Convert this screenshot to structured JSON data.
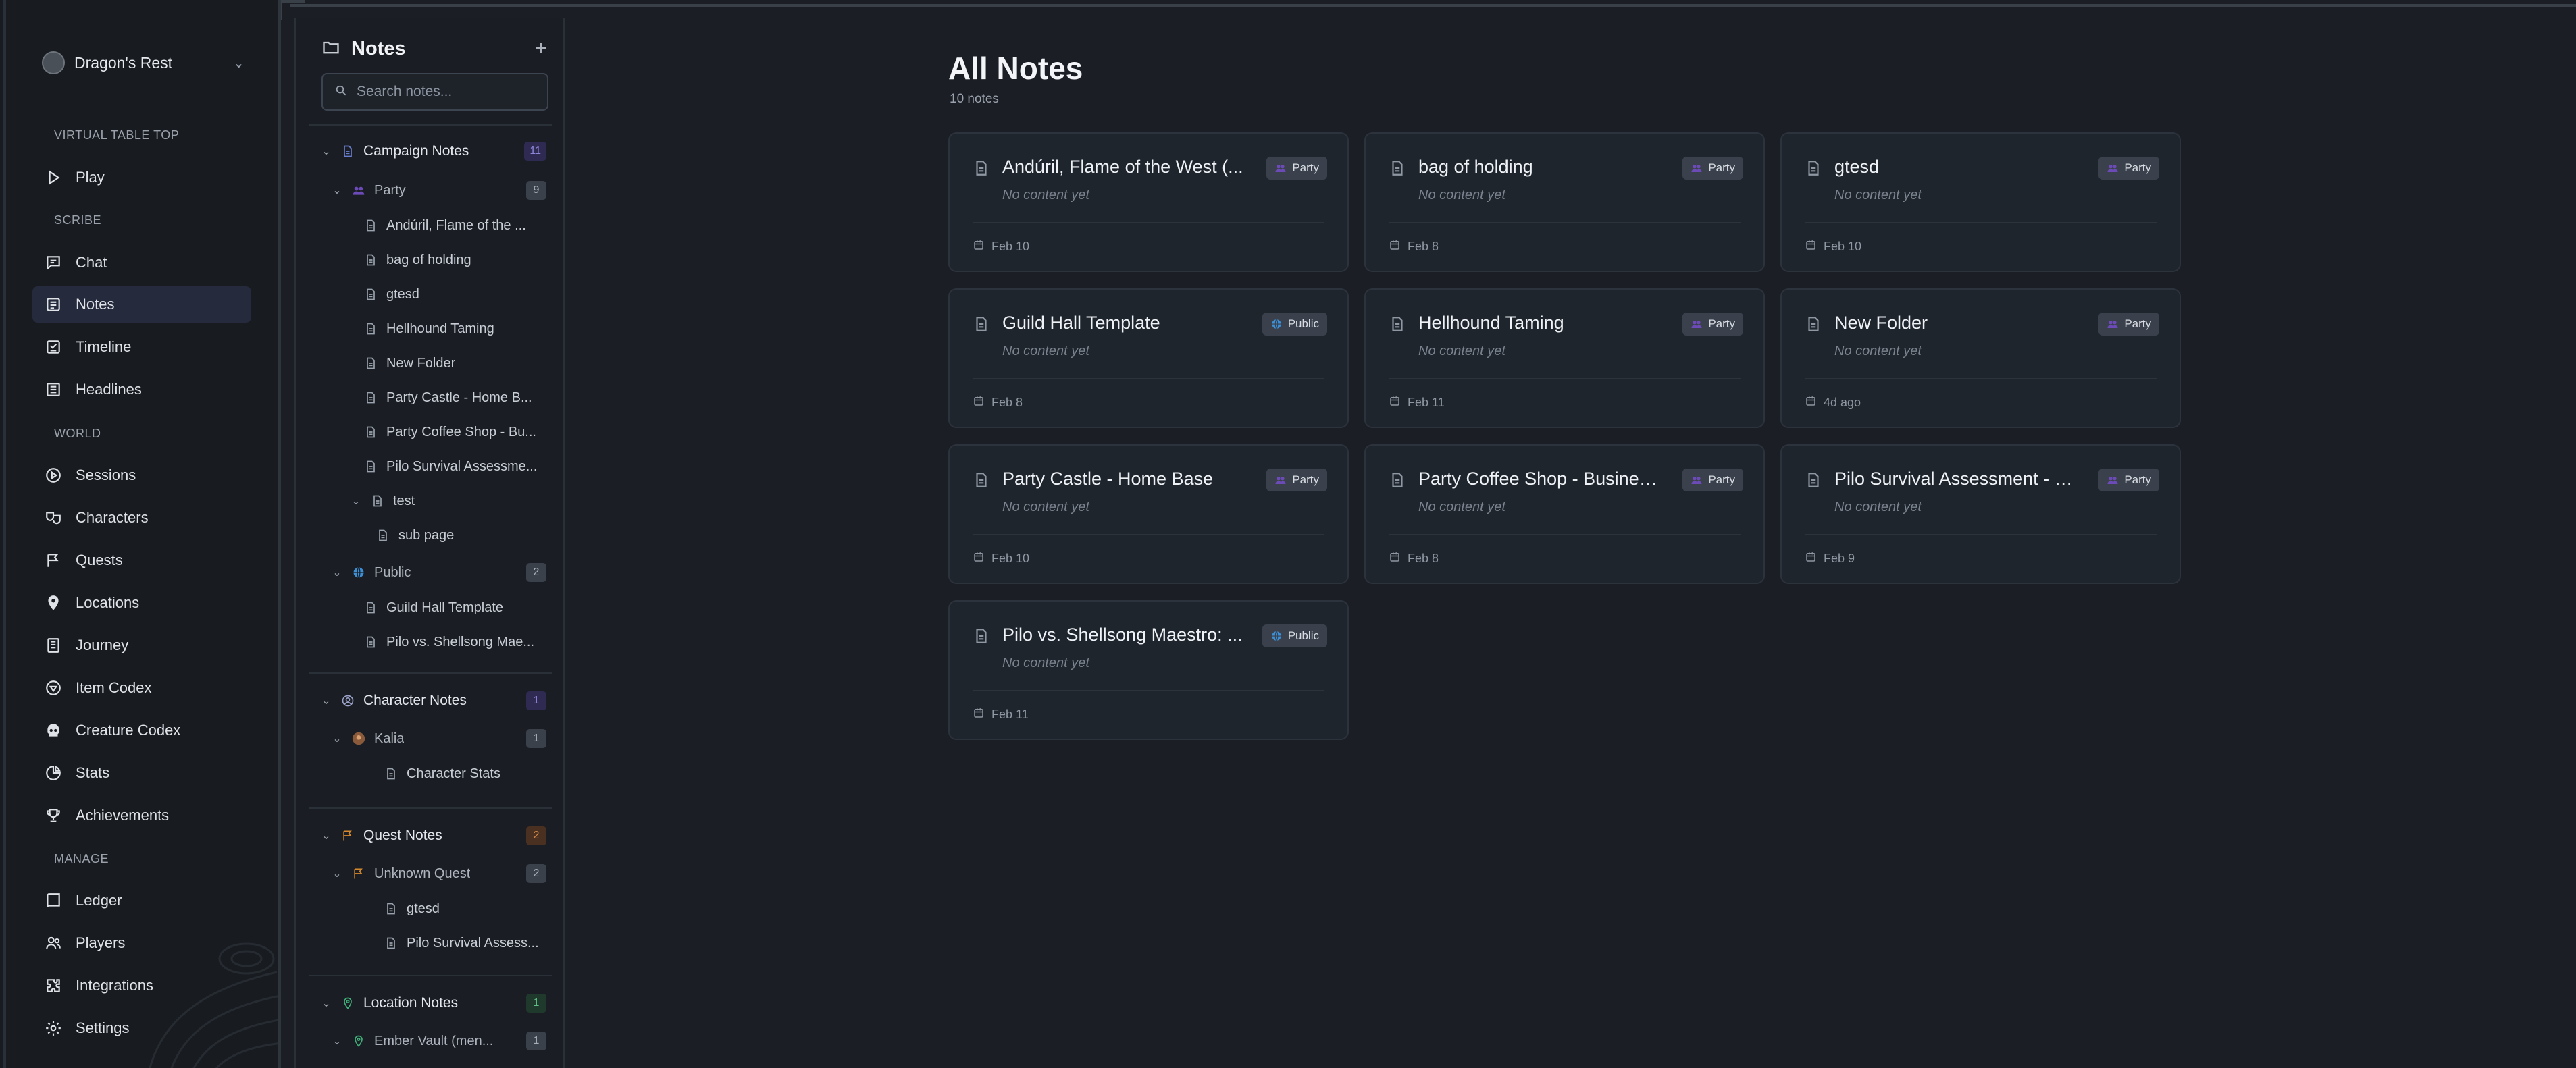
{
  "workspace": {
    "name": "Dragon's Rest"
  },
  "nav": {
    "sections": {
      "vtt": "VIRTUAL TABLE TOP",
      "scribe": "SCRIBE",
      "world": "WORLD",
      "manage": "MANAGE"
    },
    "items": {
      "play": "Play",
      "chat": "Chat",
      "notes": "Notes",
      "timeline": "Timeline",
      "headlines": "Headlines",
      "sessions": "Sessions",
      "characters": "Characters",
      "quests": "Quests",
      "locations": "Locations",
      "journey": "Journey",
      "item_codex": "Item Codex",
      "creature_codex": "Creature Codex",
      "stats": "Stats",
      "achievements": "Achievements",
      "ledger": "Ledger",
      "players": "Players",
      "integrations": "Integrations",
      "settings": "Settings"
    },
    "active": "notes"
  },
  "tree": {
    "title": "Notes",
    "search_placeholder": "Search notes...",
    "campaign": {
      "label": "Campaign Notes",
      "count": "11",
      "party": {
        "label": "Party",
        "count": "9",
        "items": [
          "Andúril, Flame of the ...",
          "bag of holding",
          "gtesd",
          "Hellhound Taming",
          "New Folder",
          "Party Castle - Home B...",
          "Party Coffee Shop - Bu...",
          "Pilo Survival Assessme..."
        ],
        "test": {
          "label": "test",
          "sub": "sub page"
        }
      },
      "public": {
        "label": "Public",
        "count": "2",
        "items": [
          "Guild Hall Template",
          "Pilo vs. Shellsong Mae..."
        ]
      }
    },
    "character": {
      "label": "Character Notes",
      "count": "1",
      "kalia": {
        "label": "Kalia",
        "count": "1",
        "item": "Character Stats"
      }
    },
    "quest": {
      "label": "Quest Notes",
      "count": "2",
      "unknown": {
        "label": "Unknown Quest",
        "count": "2",
        "items": [
          "gtesd",
          "Pilo Survival Assess..."
        ]
      }
    },
    "location": {
      "label": "Location Notes",
      "count": "1",
      "ember": {
        "label": "Ember Vault (men...",
        "count": "1"
      }
    }
  },
  "main": {
    "title": "All Notes",
    "subtitle": "10 notes",
    "empty_text": "No content yet",
    "cards": [
      {
        "title": "Andúril, Flame of the West (...",
        "badge": "Party",
        "date": "Feb 10"
      },
      {
        "title": "bag of holding",
        "badge": "Party",
        "date": "Feb 8"
      },
      {
        "title": "gtesd",
        "badge": "Party",
        "date": "Feb 10"
      },
      {
        "title": "Guild Hall Template",
        "badge": "Public",
        "date": "Feb 8"
      },
      {
        "title": "Hellhound Taming",
        "badge": "Party",
        "date": "Feb 11"
      },
      {
        "title": "New Folder",
        "badge": "Party",
        "date": "4d ago"
      },
      {
        "title": "Party Castle - Home Base",
        "badge": "Party",
        "date": "Feb 10"
      },
      {
        "title": "Party Coffee Shop - Busines...",
        "badge": "Party",
        "date": "Feb 8"
      },
      {
        "title": "Pilo Survival Assessment - S...",
        "badge": "Party",
        "date": "Feb 9"
      },
      {
        "title": "Pilo vs. Shellsong Maestro: ...",
        "badge": "Public",
        "date": "Feb 11"
      }
    ]
  },
  "colors": {
    "background": "#1b1f25",
    "sidebar": "#181c21",
    "card": "#1f252d",
    "active_nav": "#262a3d",
    "campaign_accent": "#6b7fd0",
    "party_accent": "#6c4bb8",
    "public_accent": "#3d8fd6",
    "quest_accent": "#d8892c",
    "location_accent": "#3fae78"
  }
}
